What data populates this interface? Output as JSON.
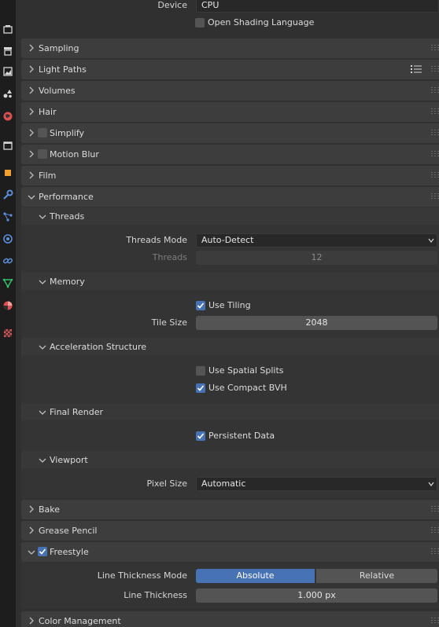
{
  "tabs": [
    {
      "icon": "render-icon",
      "color": "#d6d6d6"
    },
    {
      "icon": "output-icon",
      "color": "#d6d6d6"
    },
    {
      "icon": "view-layer-icon",
      "color": "#d6d6d6"
    },
    {
      "icon": "scene-icon",
      "color": "#d6d6d6"
    },
    {
      "icon": "world-icon",
      "color": "#e05050"
    },
    {
      "icon": "collection-icon",
      "color": "#d6d6d6"
    },
    {
      "icon": "object-icon",
      "color": "#f0a030"
    },
    {
      "icon": "modifier-icon",
      "color": "#5b8fd8"
    },
    {
      "icon": "particles-icon",
      "color": "#5b8fd8"
    },
    {
      "icon": "physics-icon",
      "color": "#5b8fd8"
    },
    {
      "icon": "constraints-icon",
      "color": "#5b8fd8"
    },
    {
      "icon": "data-icon",
      "color": "#35c06a"
    },
    {
      "icon": "material-icon",
      "color": "#e05050"
    },
    {
      "icon": "texture-icon",
      "color": "#e05050"
    }
  ],
  "device": {
    "label": "Device",
    "value": "CPU"
  },
  "osl": {
    "label": "Open Shading Language",
    "checked": false
  },
  "panels": {
    "sampling": "Sampling",
    "light_paths": "Light Paths",
    "volumes": "Volumes",
    "hair": "Hair",
    "simplify": "Simplify",
    "motion_blur": "Motion Blur",
    "film": "Film",
    "performance": "Performance",
    "bake": "Bake",
    "grease_pencil": "Grease Pencil",
    "freestyle": "Freestyle",
    "color_management": "Color Management"
  },
  "threads": {
    "title": "Threads",
    "mode_label": "Threads Mode",
    "mode_value": "Auto-Detect",
    "count_label": "Threads",
    "count_value": "12"
  },
  "memory": {
    "title": "Memory",
    "use_tiling": "Use Tiling",
    "tile_size_label": "Tile Size",
    "tile_size_value": "2048"
  },
  "accel": {
    "title": "Acceleration Structure",
    "spatial_splits": "Use Spatial Splits",
    "compact_bvh": "Use Compact BVH"
  },
  "final_render": {
    "title": "Final Render",
    "persistent_data": "Persistent Data"
  },
  "viewport": {
    "title": "Viewport",
    "pixel_size_label": "Pixel Size",
    "pixel_size_value": "Automatic"
  },
  "freestyle": {
    "thickness_mode_label": "Line Thickness Mode",
    "mode_absolute": "Absolute",
    "mode_relative": "Relative",
    "thickness_label": "Line Thickness",
    "thickness_value": "1.000 px"
  },
  "colors": {
    "accent": "#4772b3",
    "background": "#303030",
    "tab_bar": "#1d1d1d"
  }
}
